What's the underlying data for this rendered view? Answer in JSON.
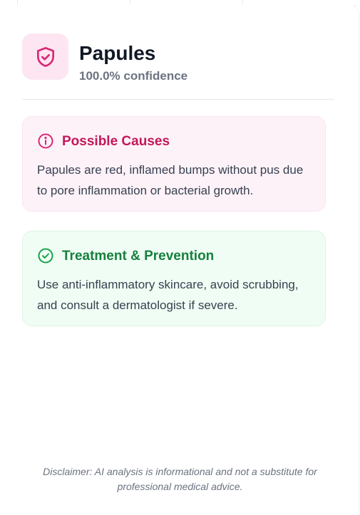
{
  "header": {
    "title": "Papules",
    "confidence": "100.0% confidence",
    "icon": "shield-check-icon"
  },
  "causes": {
    "title": "Possible Causes",
    "text": "Papules are red, inflamed bumps without pus due to pore inflammation or bacterial growth.",
    "icon": "info-circle-icon",
    "accent": "#c2185b"
  },
  "treatment": {
    "title": "Treatment & Prevention",
    "text": "Use anti-inflammatory skincare, avoid scrubbing, and consult a dermatologist if severe.",
    "icon": "check-circle-icon",
    "accent": "#15803d"
  },
  "disclaimer": "Disclaimer: AI analysis is informational and not a substitute for professional medical advice."
}
